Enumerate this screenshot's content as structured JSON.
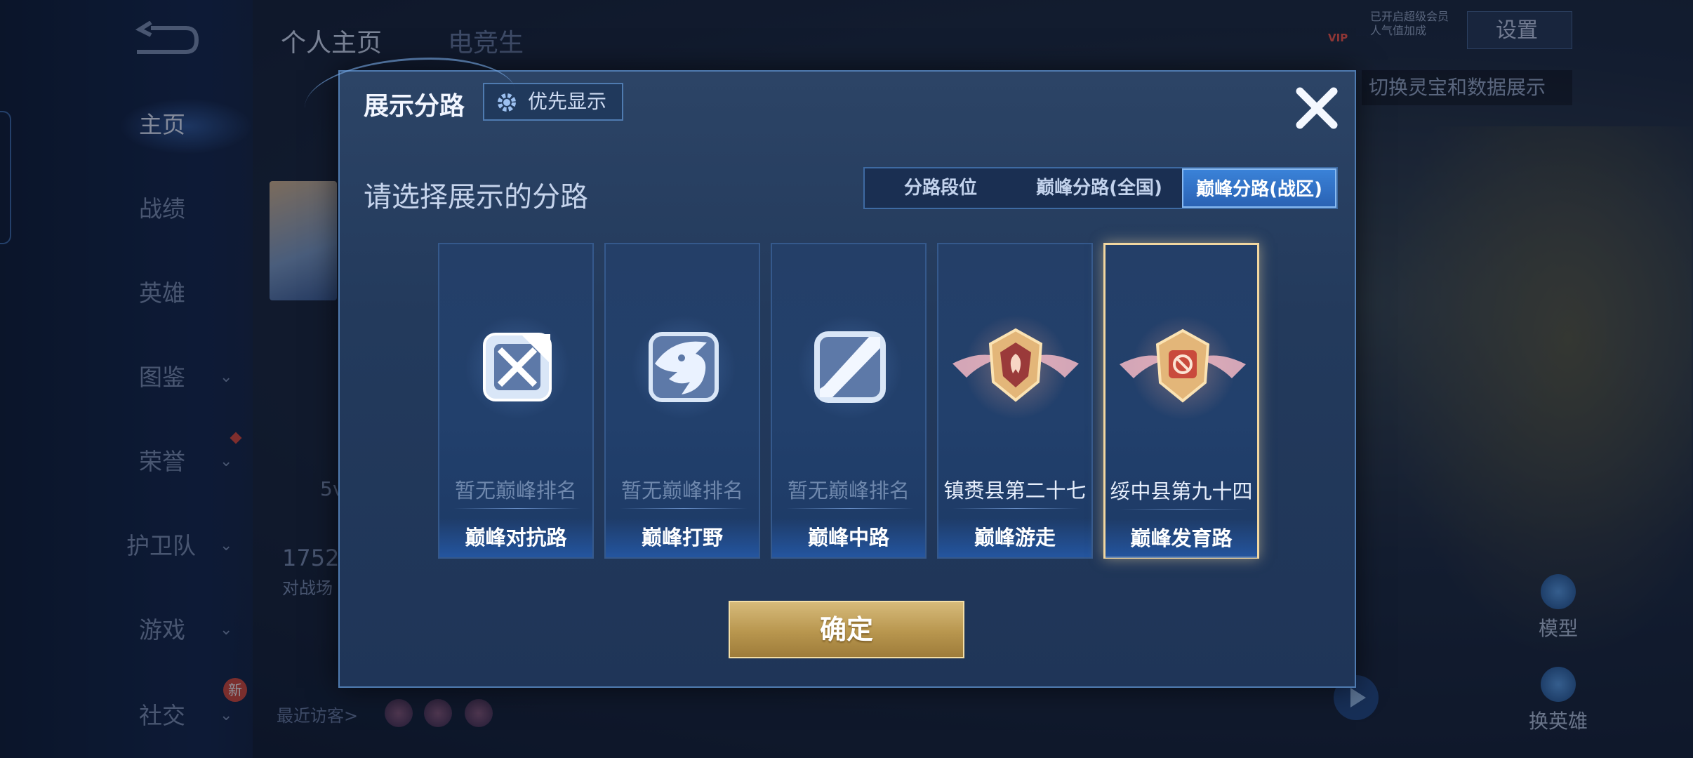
{
  "background": {
    "tabs": {
      "profile": "个人主页",
      "esports": "电竞生"
    },
    "nav": [
      {
        "label": "主页"
      },
      {
        "label": "战绩"
      },
      {
        "label": "英雄"
      },
      {
        "label": "图鉴"
      },
      {
        "label": "荣誉"
      },
      {
        "label": "护卫队"
      },
      {
        "label": "游戏"
      },
      {
        "label": "社交"
      }
    ],
    "new_badge": "新",
    "settings_label": "设置",
    "vip": {
      "badge": "VIP",
      "line1": "已开启超级会员",
      "line2": "人气值加成"
    },
    "hint_text": "切换灵宝和数据展示",
    "partial_texts": {
      "fight_count": "1752",
      "fight_label": "对战场",
      "level": "5v"
    },
    "recent_visitors_label": "最近访客>",
    "side_actions": {
      "model": "模型",
      "switch_hero": "换英雄"
    }
  },
  "modal": {
    "title": "展示分路",
    "priority_button": "优先显示",
    "subtitle": "请选择展示的分路",
    "segments": [
      {
        "label": "分路段位",
        "active": false
      },
      {
        "label": "巅峰分路(全国)",
        "active": false
      },
      {
        "label": "巅峰分路(战区)",
        "active": true
      }
    ],
    "cards": [
      {
        "rank": "暂无巅峰排名",
        "lane": "巅峰对抗路",
        "emblem": "clash-lane-icon",
        "selected": false
      },
      {
        "rank": "暂无巅峰排名",
        "lane": "巅峰打野",
        "emblem": "jungle-dragon-icon",
        "selected": false
      },
      {
        "rank": "暂无巅峰排名",
        "lane": "巅峰中路",
        "emblem": "mid-lane-icon",
        "selected": false
      },
      {
        "rank": "镇赉县第二十七",
        "lane": "巅峰游走",
        "emblem": "roam-gold-badge-icon",
        "selected": false
      },
      {
        "rank": "绥中县第九十四",
        "lane": "巅峰发育路",
        "emblem": "farm-gold-badge-icon",
        "selected": true
      }
    ],
    "confirm_button": "确定"
  },
  "colors": {
    "modal_bg": "#233a5c",
    "active_segment": "#3a82d8",
    "confirm_gold": "#b8964e",
    "selected_border": "#f2d7a0"
  }
}
